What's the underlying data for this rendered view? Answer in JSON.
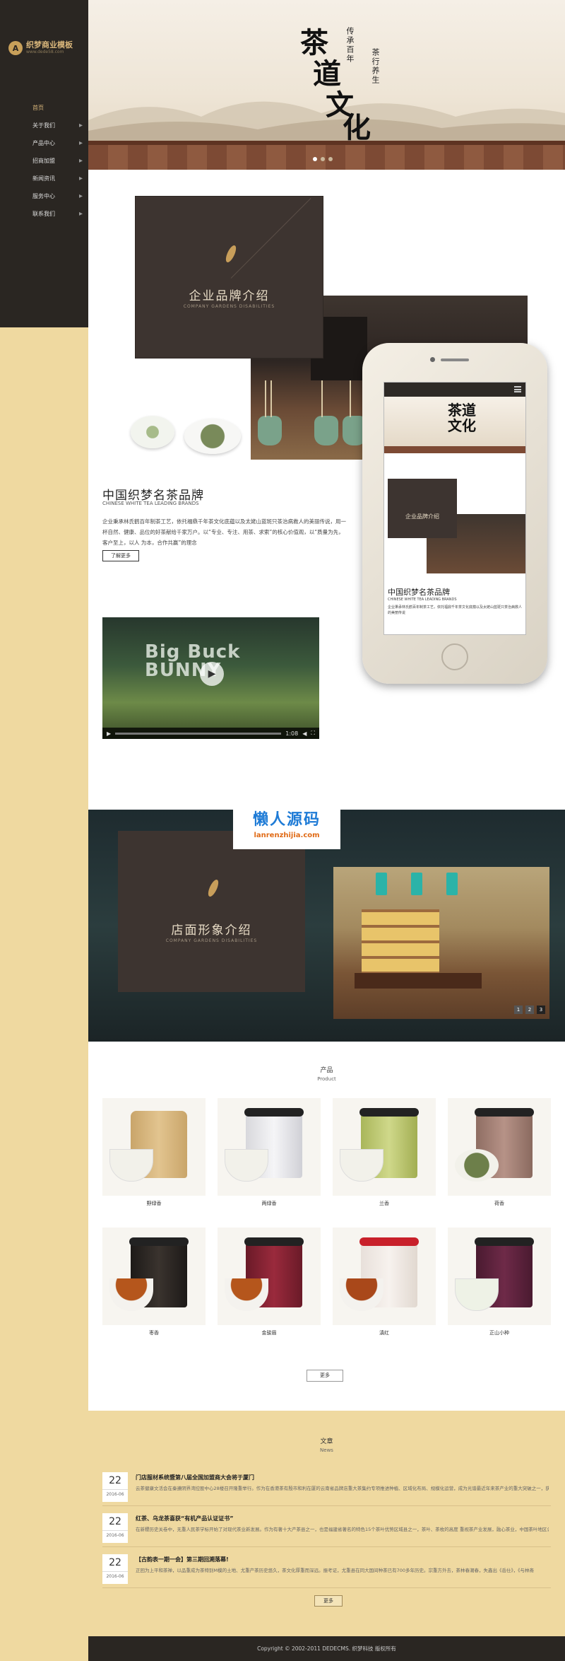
{
  "logo": {
    "title": "织梦商业模板",
    "subtitle": "www.dede58.com"
  },
  "nav": [
    {
      "label": "首页",
      "active": true,
      "arrow": ""
    },
    {
      "label": "关于我们",
      "arrow": "▸"
    },
    {
      "label": "产品中心",
      "arrow": "▸"
    },
    {
      "label": "招商加盟",
      "arrow": "▸"
    },
    {
      "label": "新闻资讯",
      "arrow": "▸"
    },
    {
      "label": "服务中心",
      "arrow": "▸"
    },
    {
      "label": "联系我们",
      "arrow": "▸"
    }
  ],
  "hero": {
    "char1": "茶",
    "char2": "道",
    "char3": "文",
    "char4": "化",
    "vert1": "传承百年",
    "vert2": "茶行养生",
    "dots": 3
  },
  "brand": {
    "box_title": "企业品牌介绍",
    "box_sub": "COMPANY GARDENS DISABILITIES",
    "title": "中国织梦名茶品牌",
    "subtitle": "CHINESE WHITE TEA LEADING BRANDS",
    "desc": "企业秉承林氏鹤百年制茶工艺，依托福鼎千年茶文化底蕴以及太姥山蓝斑只茶治病救人的美丽传说，用一杯自然、健康、品位的好茶献给千家万户。以“专业、专注、用茶、求索”的核心价值观，以“质量为先，客户至上，以人 为本，合作共赢”的理念",
    "more": "了解更多"
  },
  "video": {
    "line1": "Big Buck",
    "line2": "BUNNY",
    "time": "1:08",
    "play": "▶"
  },
  "phone": {
    "m_char1": "茶道",
    "m_char2": "文化",
    "m_box": "企业品牌介绍",
    "m_title": "中国织梦名茶品牌",
    "m_sub": "CHINESE WHITE TEA LEADING BRANDS",
    "m_desc": "企业秉承林氏鹤百年制茶工艺，依托福鼎千年茶文化底蕴以及太姥山蓝斑只茶治病救人的美丽传说"
  },
  "watermark": {
    "title": "懒人源码",
    "url": "lanrenzhijia.com"
  },
  "store": {
    "box_title": "店面形象介绍",
    "box_sub": "COMPANY GARDENS DISABILITIES",
    "pages": [
      "1",
      "2",
      "3"
    ]
  },
  "products": {
    "title": "产品",
    "subtitle": "Product",
    "items": [
      {
        "name": "野绿香"
      },
      {
        "name": "两绿香"
      },
      {
        "name": "兰香"
      },
      {
        "name": "荷香"
      },
      {
        "name": "枣香"
      },
      {
        "name": "金骏眉"
      },
      {
        "name": "滇红"
      },
      {
        "name": "正山小种"
      }
    ],
    "more": "更多"
  },
  "news": {
    "title": "文章",
    "subtitle": "News",
    "items": [
      {
        "day": "22",
        "year": "2016-06",
        "title": "门店服材系统暨第八届全国加盟商大会将于厦门",
        "text": "云茶健康文活会在秦遵阴界湾控股中心28楼召开隆重举行。作为在香港茶有殷市和利在厦的云南省品牌店重大茶集约专项推进种植、区域化布局、规模化运营，成为光谱最近年来茶产业的重大突破之一，获批设立…"
      },
      {
        "day": "22",
        "year": "2016-06",
        "title": "红茶、乌龙茶喜获“有机产品认证证书”",
        "text": "在新稷历史关卷中，无重人民茶学标开始了对现代茶业新发展。作为有著十大产茶县之一，也是福建省著名的特色15个茶叶优势区域县之一，茶叶、茶枚的高度 重视茶产业发展，融心茶业，中国茶叶地区公投"
      },
      {
        "day": "22",
        "year": "2016-06",
        "title": "【古韵表一期一会】第三期回溯落幕!",
        "text": "正回为上平和茶禅，以品重成为茶特别M模的土地、尤重产茶历史悠久，茶文化厚重而深远。振考证，尤重县在同大国间种茶已有700多年历史。宗重方外去，茶林春潮春，失鑫出《岳仕》，《与林斋"
      }
    ],
    "more": "更多"
  },
  "footer": {
    "text": "Copyright © 2002-2011 DEDECMS. 织梦科技 版权所有"
  }
}
